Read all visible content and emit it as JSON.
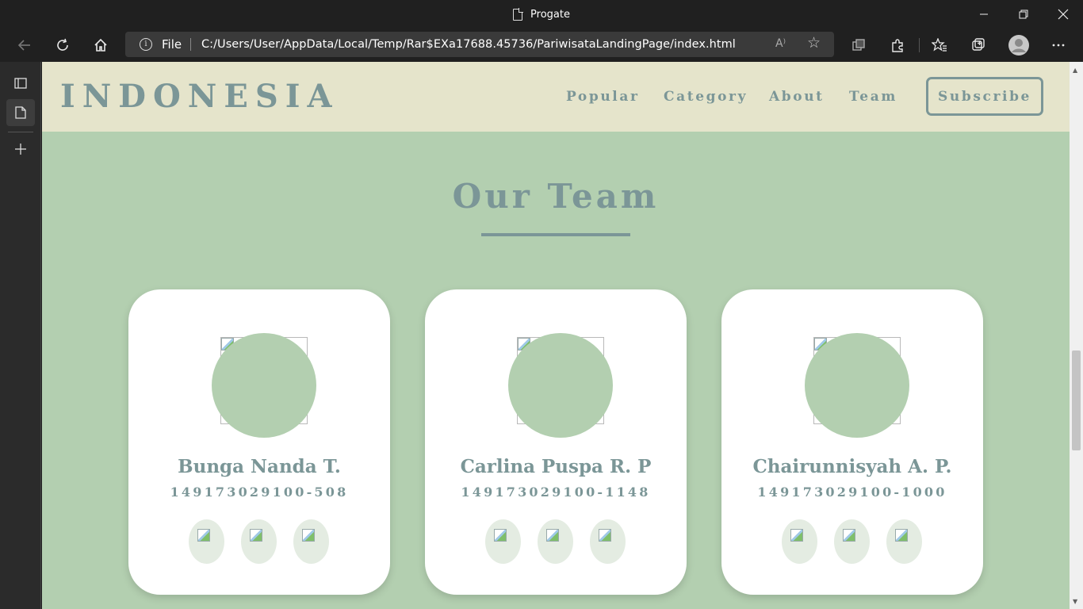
{
  "browser": {
    "tab_title": "Progate",
    "address": {
      "scheme_label": "File",
      "url": "C:/Users/User/AppData/Local/Temp/Rar$EXa17688.45736/PariwisataLandingPage/index.html",
      "read_aloud": "A⁾"
    },
    "icons": [
      "back-icon",
      "refresh-icon",
      "home-icon",
      "info-icon",
      "read-aloud-icon",
      "add-favorite-icon",
      "tab-actions-icon",
      "extensions-icon",
      "favorites-icon",
      "collections-icon",
      "profile-icon",
      "more-icon",
      "minimize-icon",
      "restore-icon",
      "close-icon"
    ]
  },
  "site": {
    "logo": "INDONESIA",
    "nav": [
      "Popular",
      "Category",
      "About",
      "Team"
    ],
    "subscribe": "Subscribe",
    "section_title": "Our Team",
    "accent_color": "#7b9697",
    "header_bg": "#e5e4cb",
    "section_bg": "#b3cfb0",
    "team": [
      {
        "name": "Bunga Nanda T.",
        "id": "149173029100-508"
      },
      {
        "name": "Carlina Puspa R. P",
        "id": "149173029100-1148"
      },
      {
        "name": "Chairunnisyah A. P.",
        "id": "149173029100-1000"
      }
    ]
  }
}
